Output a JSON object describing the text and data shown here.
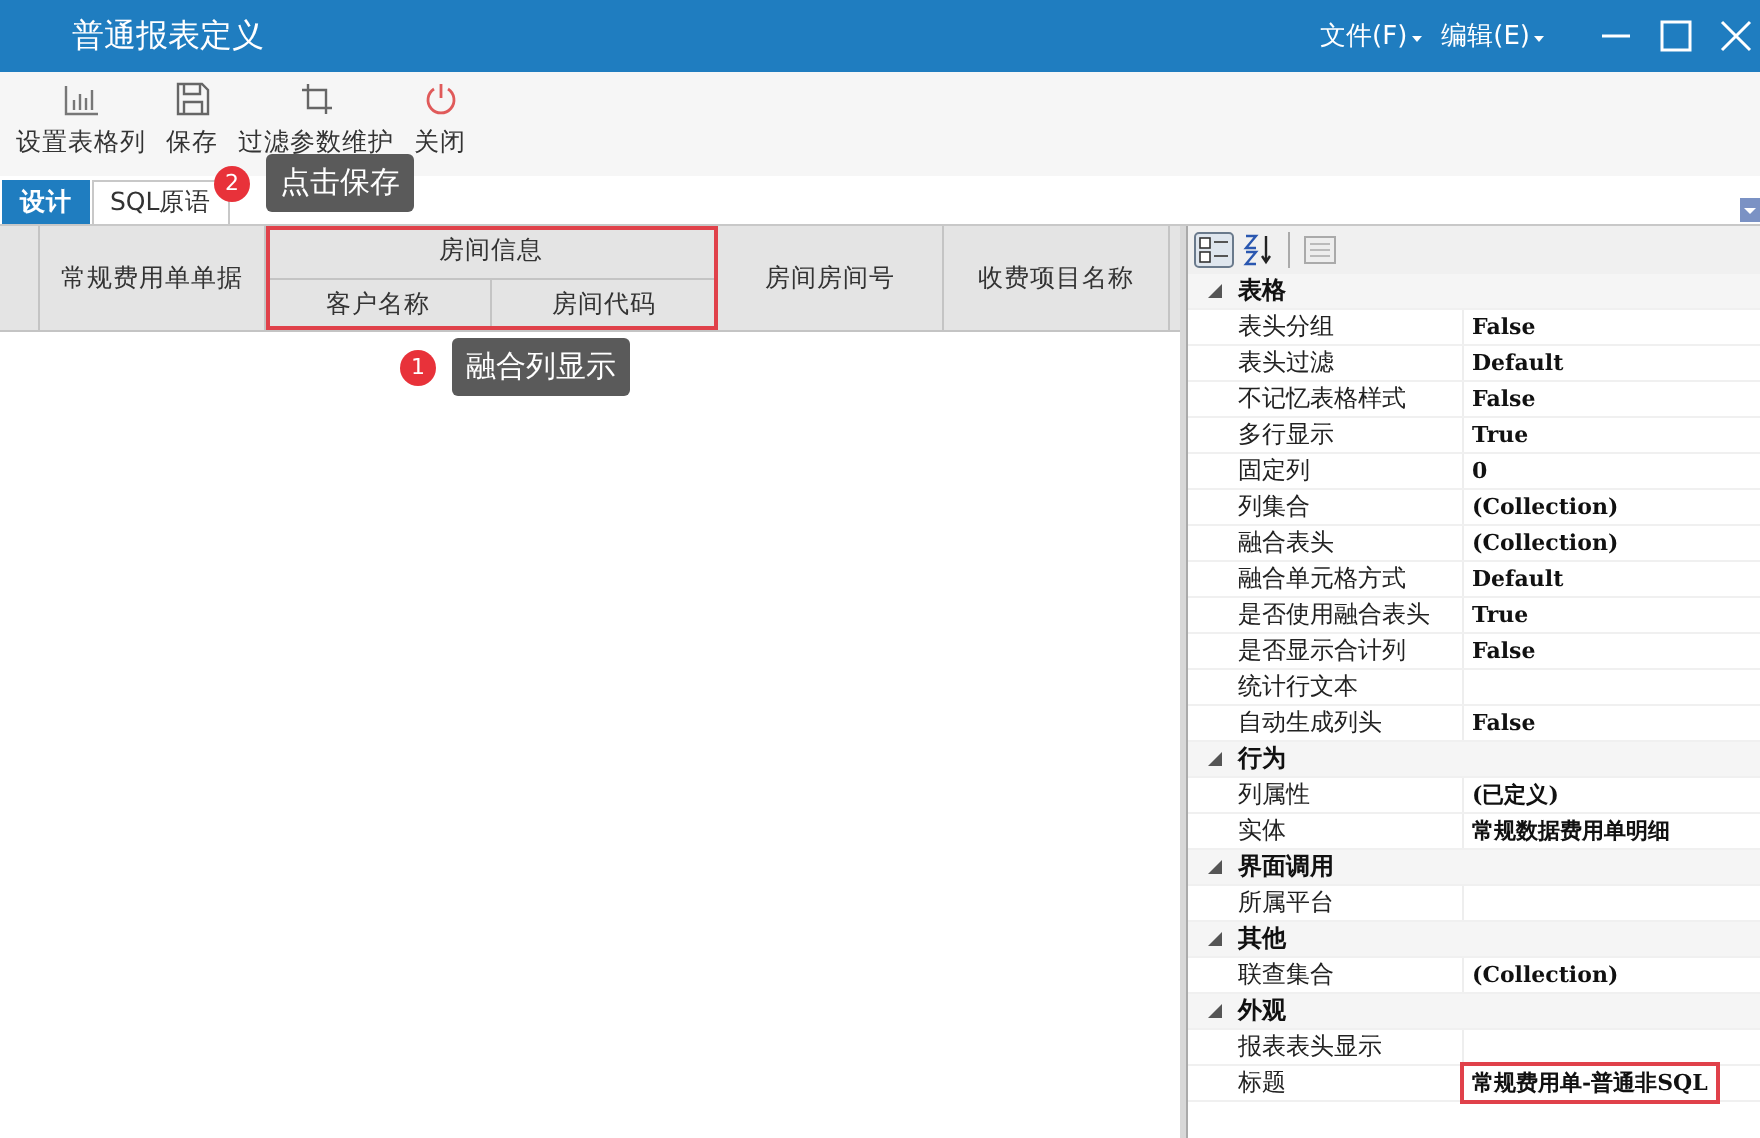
{
  "window": {
    "title": "普通报表定义",
    "menus": [
      "文件(F)",
      "编辑(E)"
    ]
  },
  "toolbar": [
    {
      "label": "设置表格列",
      "kind": "chart"
    },
    {
      "label": "保存",
      "kind": "save"
    },
    {
      "label": "过滤参数维护",
      "kind": "crop"
    },
    {
      "label": "关闭",
      "kind": "power"
    }
  ],
  "tabs": [
    {
      "label": "设计",
      "selected": true
    },
    {
      "label": "SQL原语",
      "selected": false
    }
  ],
  "grid_header": [
    {
      "label": "常规费用单单据"
    },
    {
      "label": "房间信息",
      "children": [
        {
          "label": "客户名称"
        },
        {
          "label": "房间代码"
        }
      ],
      "highlighted": true
    },
    {
      "label": "房间房间号"
    },
    {
      "label": "收费项目名称"
    }
  ],
  "annotations": [
    {
      "number": "1",
      "text": "融合列显示"
    },
    {
      "number": "2",
      "text": "点击保存"
    }
  ],
  "properties": [
    {
      "kind": "category",
      "name": "表格",
      "expanded": true
    },
    {
      "kind": "property",
      "name": "表头分组",
      "value": "False"
    },
    {
      "kind": "property",
      "name": "表头过滤",
      "value": "Default"
    },
    {
      "kind": "property",
      "name": "不记忆表格样式",
      "value": "False"
    },
    {
      "kind": "property",
      "name": "多行显示",
      "value": "True"
    },
    {
      "kind": "property",
      "name": "固定列",
      "value": "0"
    },
    {
      "kind": "property",
      "name": "列集合",
      "value": "(Collection)"
    },
    {
      "kind": "property",
      "name": "融合表头",
      "value": "(Collection)"
    },
    {
      "kind": "property",
      "name": "融合单元格方式",
      "value": "Default"
    },
    {
      "kind": "property",
      "name": "是否使用融合表头",
      "value": "True"
    },
    {
      "kind": "property",
      "name": "是否显示合计列",
      "value": "False"
    },
    {
      "kind": "property",
      "name": "统计行文本"
    },
    {
      "kind": "property",
      "name": "自动生成列头",
      "value": "False"
    },
    {
      "kind": "category",
      "name": "行为",
      "expanded": true
    },
    {
      "kind": "property",
      "name": "列属性",
      "value": "(已定义)"
    },
    {
      "kind": "property",
      "name": "实体",
      "value": "常规数据费用单明细"
    },
    {
      "kind": "category",
      "name": "界面调用",
      "expanded": true
    },
    {
      "kind": "property",
      "name": "所属平台"
    },
    {
      "kind": "category",
      "name": "其他",
      "expanded": true
    },
    {
      "kind": "property",
      "name": "联查集合",
      "value": "(Collection)"
    },
    {
      "kind": "category",
      "name": "外观",
      "expanded": true
    },
    {
      "kind": "property",
      "name": "报表表头显示"
    },
    {
      "kind": "property",
      "name": "标题",
      "value": "常规费用单-普通非SQL",
      "highlighted": true
    }
  ]
}
